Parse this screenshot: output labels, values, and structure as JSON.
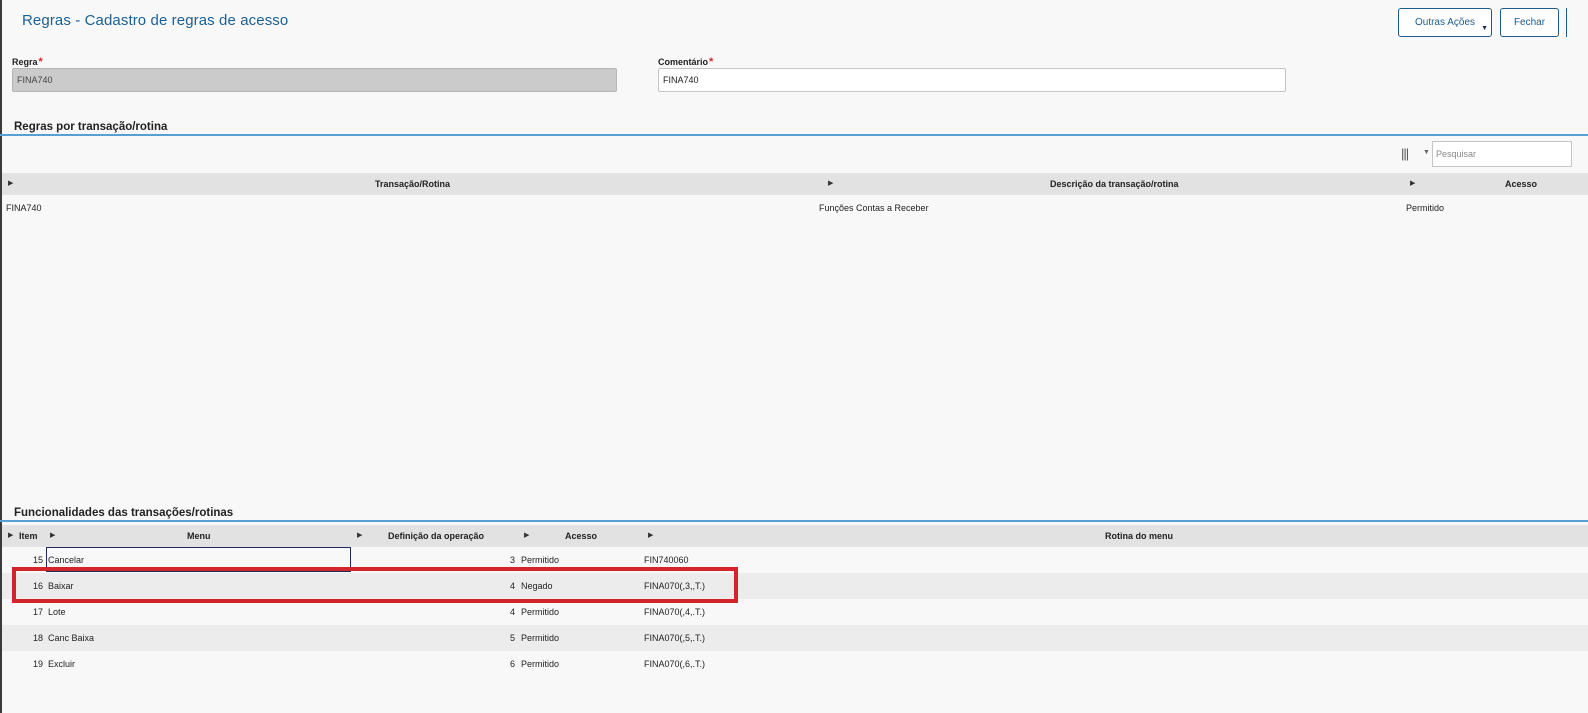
{
  "header": {
    "title": "Regras - Cadastro de regras de acesso",
    "other_actions_label": "Outras Ações",
    "close_label": "Fechar"
  },
  "form": {
    "rule_label": "Regra",
    "rule_value": "FINA740",
    "comment_label": "Comentário",
    "comment_value": "FINA740",
    "required_mark": "*"
  },
  "transactions": {
    "section_title": "Regras por transação/rotina",
    "search_placeholder": "Pesquisar",
    "columns": [
      "Transação/Rotina",
      "Descrição da transação/rotina",
      "Acesso"
    ],
    "rows": [
      {
        "transaction": "FINA740",
        "description": "Funções Contas a Receber",
        "access": "Permitido"
      }
    ]
  },
  "functionalities": {
    "section_title": "Funcionalidades das transações/rotinas",
    "columns": [
      "Item",
      "Menu",
      "Definição da operação",
      "Acesso",
      "Rotina do menu"
    ],
    "rows": [
      {
        "item": "15",
        "menu": "Cancelar",
        "operation": "3",
        "access": "Permitido",
        "routine": "FIN740060"
      },
      {
        "item": "16",
        "menu": "Baixar",
        "operation": "4",
        "access": "Negado",
        "routine": "FINA070(,3,,T.)"
      },
      {
        "item": "17",
        "menu": "Lote",
        "operation": "4",
        "access": "Permitido",
        "routine": "FINA070(,4,.T.)"
      },
      {
        "item": "18",
        "menu": "Canc Baixa",
        "operation": "5",
        "access": "Permitido",
        "routine": "FINA070(,5,.T.)"
      },
      {
        "item": "19",
        "menu": "Excluir",
        "operation": "6",
        "access": "Permitido",
        "routine": "FINA070(,6,.T.)"
      }
    ]
  },
  "colors": {
    "accent": "#1d5a8e",
    "section_line": "#5a9fd4",
    "highlight": "#d3232b",
    "required": "#d8262d"
  }
}
